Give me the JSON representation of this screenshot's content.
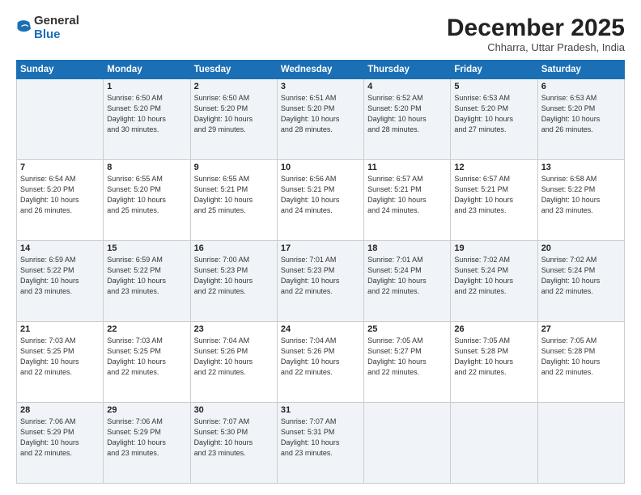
{
  "logo": {
    "general": "General",
    "blue": "Blue"
  },
  "title": "December 2025",
  "subtitle": "Chharra, Uttar Pradesh, India",
  "days_header": [
    "Sunday",
    "Monday",
    "Tuesday",
    "Wednesday",
    "Thursday",
    "Friday",
    "Saturday"
  ],
  "weeks": [
    [
      {
        "num": "",
        "info": ""
      },
      {
        "num": "1",
        "info": "Sunrise: 6:50 AM\nSunset: 5:20 PM\nDaylight: 10 hours\nand 30 minutes."
      },
      {
        "num": "2",
        "info": "Sunrise: 6:50 AM\nSunset: 5:20 PM\nDaylight: 10 hours\nand 29 minutes."
      },
      {
        "num": "3",
        "info": "Sunrise: 6:51 AM\nSunset: 5:20 PM\nDaylight: 10 hours\nand 28 minutes."
      },
      {
        "num": "4",
        "info": "Sunrise: 6:52 AM\nSunset: 5:20 PM\nDaylight: 10 hours\nand 28 minutes."
      },
      {
        "num": "5",
        "info": "Sunrise: 6:53 AM\nSunset: 5:20 PM\nDaylight: 10 hours\nand 27 minutes."
      },
      {
        "num": "6",
        "info": "Sunrise: 6:53 AM\nSunset: 5:20 PM\nDaylight: 10 hours\nand 26 minutes."
      }
    ],
    [
      {
        "num": "7",
        "info": "Sunrise: 6:54 AM\nSunset: 5:20 PM\nDaylight: 10 hours\nand 26 minutes."
      },
      {
        "num": "8",
        "info": "Sunrise: 6:55 AM\nSunset: 5:20 PM\nDaylight: 10 hours\nand 25 minutes."
      },
      {
        "num": "9",
        "info": "Sunrise: 6:55 AM\nSunset: 5:21 PM\nDaylight: 10 hours\nand 25 minutes."
      },
      {
        "num": "10",
        "info": "Sunrise: 6:56 AM\nSunset: 5:21 PM\nDaylight: 10 hours\nand 24 minutes."
      },
      {
        "num": "11",
        "info": "Sunrise: 6:57 AM\nSunset: 5:21 PM\nDaylight: 10 hours\nand 24 minutes."
      },
      {
        "num": "12",
        "info": "Sunrise: 6:57 AM\nSunset: 5:21 PM\nDaylight: 10 hours\nand 23 minutes."
      },
      {
        "num": "13",
        "info": "Sunrise: 6:58 AM\nSunset: 5:22 PM\nDaylight: 10 hours\nand 23 minutes."
      }
    ],
    [
      {
        "num": "14",
        "info": "Sunrise: 6:59 AM\nSunset: 5:22 PM\nDaylight: 10 hours\nand 23 minutes."
      },
      {
        "num": "15",
        "info": "Sunrise: 6:59 AM\nSunset: 5:22 PM\nDaylight: 10 hours\nand 23 minutes."
      },
      {
        "num": "16",
        "info": "Sunrise: 7:00 AM\nSunset: 5:23 PM\nDaylight: 10 hours\nand 22 minutes."
      },
      {
        "num": "17",
        "info": "Sunrise: 7:01 AM\nSunset: 5:23 PM\nDaylight: 10 hours\nand 22 minutes."
      },
      {
        "num": "18",
        "info": "Sunrise: 7:01 AM\nSunset: 5:24 PM\nDaylight: 10 hours\nand 22 minutes."
      },
      {
        "num": "19",
        "info": "Sunrise: 7:02 AM\nSunset: 5:24 PM\nDaylight: 10 hours\nand 22 minutes."
      },
      {
        "num": "20",
        "info": "Sunrise: 7:02 AM\nSunset: 5:24 PM\nDaylight: 10 hours\nand 22 minutes."
      }
    ],
    [
      {
        "num": "21",
        "info": "Sunrise: 7:03 AM\nSunset: 5:25 PM\nDaylight: 10 hours\nand 22 minutes."
      },
      {
        "num": "22",
        "info": "Sunrise: 7:03 AM\nSunset: 5:25 PM\nDaylight: 10 hours\nand 22 minutes."
      },
      {
        "num": "23",
        "info": "Sunrise: 7:04 AM\nSunset: 5:26 PM\nDaylight: 10 hours\nand 22 minutes."
      },
      {
        "num": "24",
        "info": "Sunrise: 7:04 AM\nSunset: 5:26 PM\nDaylight: 10 hours\nand 22 minutes."
      },
      {
        "num": "25",
        "info": "Sunrise: 7:05 AM\nSunset: 5:27 PM\nDaylight: 10 hours\nand 22 minutes."
      },
      {
        "num": "26",
        "info": "Sunrise: 7:05 AM\nSunset: 5:28 PM\nDaylight: 10 hours\nand 22 minutes."
      },
      {
        "num": "27",
        "info": "Sunrise: 7:05 AM\nSunset: 5:28 PM\nDaylight: 10 hours\nand 22 minutes."
      }
    ],
    [
      {
        "num": "28",
        "info": "Sunrise: 7:06 AM\nSunset: 5:29 PM\nDaylight: 10 hours\nand 22 minutes."
      },
      {
        "num": "29",
        "info": "Sunrise: 7:06 AM\nSunset: 5:29 PM\nDaylight: 10 hours\nand 23 minutes."
      },
      {
        "num": "30",
        "info": "Sunrise: 7:07 AM\nSunset: 5:30 PM\nDaylight: 10 hours\nand 23 minutes."
      },
      {
        "num": "31",
        "info": "Sunrise: 7:07 AM\nSunset: 5:31 PM\nDaylight: 10 hours\nand 23 minutes."
      },
      {
        "num": "",
        "info": ""
      },
      {
        "num": "",
        "info": ""
      },
      {
        "num": "",
        "info": ""
      }
    ]
  ]
}
